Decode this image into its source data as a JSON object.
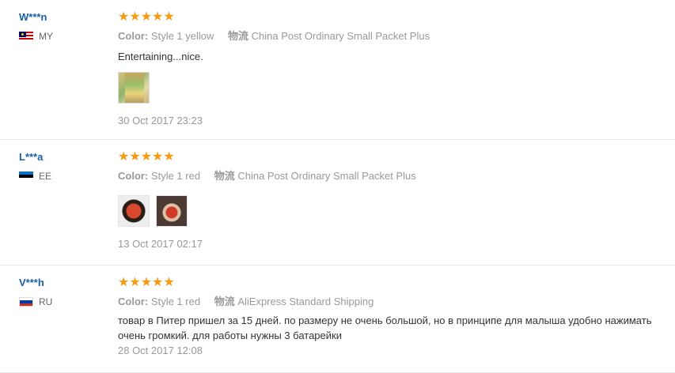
{
  "reviews": [
    {
      "user": "W***n",
      "country": "MY",
      "stars": "★★★★★",
      "color_label": "Color:",
      "color_value": "Style 1 yellow",
      "ship_label": "物流",
      "ship_value": "China Post Ordinary Small Packet Plus",
      "text": "Entertaining...nice.",
      "date": "30 Oct 2017 23:23"
    },
    {
      "user": "L***a",
      "country": "EE",
      "stars": "★★★★★",
      "color_label": "Color:",
      "color_value": "Style 1 red",
      "ship_label": "物流",
      "ship_value": "China Post Ordinary Small Packet Plus",
      "date": "13 Oct 2017 02:17"
    },
    {
      "user": "V***h",
      "country": "RU",
      "stars": "★★★★★",
      "color_label": "Color:",
      "color_value": "Style 1 red",
      "ship_label": "物流",
      "ship_value": "AliExpress Standard Shipping",
      "text_line1": "товар в Питер пришел за 15 дней. по размеру не очень большой, но в принципе для малыша удобно нажимать",
      "text_line2": "очень громкий. для работы нужны 3 батарейки",
      "date": "28 Oct 2017 12:08"
    }
  ],
  "colors": {
    "username": "#1a5ea8",
    "star": "#f79a13",
    "muted": "#999999"
  }
}
